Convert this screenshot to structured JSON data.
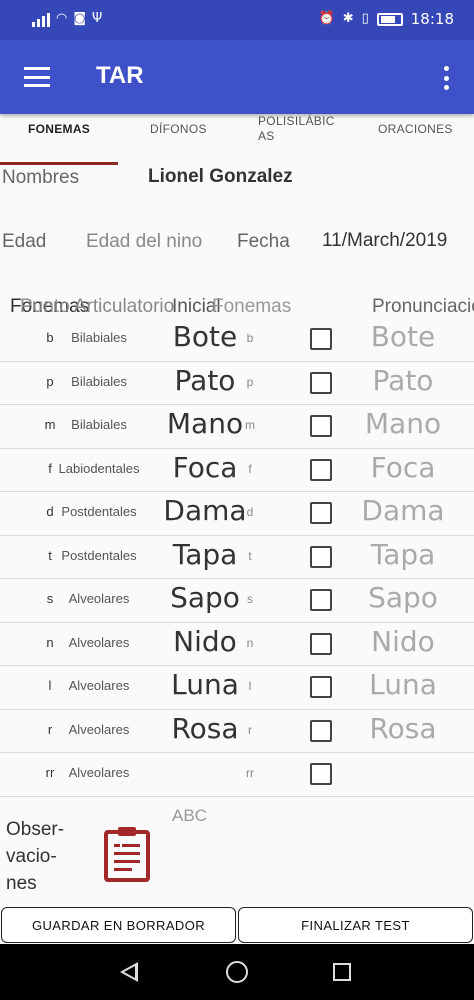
{
  "status_bar": {
    "time": "18:18"
  },
  "app_bar": {
    "title": "TAR"
  },
  "tabs": [
    {
      "label": "FONEMAS",
      "active": true
    },
    {
      "label": "DÍFONOS",
      "active": false
    },
    {
      "label": "POLISILÁBIC AS",
      "active": false
    },
    {
      "label": "ORACIONES",
      "active": false
    }
  ],
  "form": {
    "nombres_label": "Nombres",
    "nombres_value": "Lionel Gonzalez",
    "edad_label": "Edad",
    "edad_placeholder": "Edad del nino",
    "fecha_label": "Fecha",
    "fecha_value": "11/March/2019"
  },
  "table": {
    "headers": {
      "fonemas": "Fonemas",
      "punto": "Punto Articulatorio",
      "inicial": "Inicial",
      "fonemas2": "Fonemas",
      "pronunciacion": "Pronunciacion"
    },
    "rows": [
      {
        "fonema": "b",
        "articulacion": "Bilabiales",
        "palabra": "Bote",
        "fonema2": "b",
        "pronunciacion": "Bote"
      },
      {
        "fonema": "p",
        "articulacion": "Bilabiales",
        "palabra": "Pato",
        "fonema2": "p",
        "pronunciacion": "Pato"
      },
      {
        "fonema": "m",
        "articulacion": "Bilabiales",
        "palabra": "Mano",
        "fonema2": "m",
        "pronunciacion": "Mano"
      },
      {
        "fonema": "f",
        "articulacion": "Labiodentales",
        "palabra": "Foca",
        "fonema2": "f",
        "pronunciacion": "Foca"
      },
      {
        "fonema": "d",
        "articulacion": "Postdentales",
        "palabra": "Dama",
        "fonema2": "d",
        "pronunciacion": "Dama"
      },
      {
        "fonema": "t",
        "articulacion": "Postdentales",
        "palabra": "Tapa",
        "fonema2": "t",
        "pronunciacion": "Tapa"
      },
      {
        "fonema": "s",
        "articulacion": "Alveolares",
        "palabra": "Sapo",
        "fonema2": "s",
        "pronunciacion": "Sapo"
      },
      {
        "fonema": "n",
        "articulacion": "Alveolares",
        "palabra": "Nido",
        "fonema2": "n",
        "pronunciacion": "Nido"
      },
      {
        "fonema": "l",
        "articulacion": "Alveolares",
        "palabra": "Luna",
        "fonema2": "l",
        "pronunciacion": "Luna"
      },
      {
        "fonema": "r",
        "articulacion": "Alveolares",
        "palabra": "Rosa",
        "fonema2": "r",
        "pronunciacion": "Rosa"
      },
      {
        "fonema": "rr",
        "articulacion": "Alveolares",
        "palabra": "",
        "fonema2": "rr",
        "pronunciacion": ""
      }
    ]
  },
  "observaciones": {
    "label_line1": "Obser-",
    "label_line2": "vacio-",
    "label_line3": "nes",
    "placeholder": "ABC",
    "icon": "clipboard-icon"
  },
  "buttons": {
    "save_draft": "GUARDAR EN BORRADOR",
    "finish": "FINALIZAR TEST"
  },
  "colors": {
    "status_bar": "#3648b8",
    "app_bar": "#3f51c9",
    "tab_indicator": "#8b2a24",
    "clipboard": "#a3282a"
  }
}
